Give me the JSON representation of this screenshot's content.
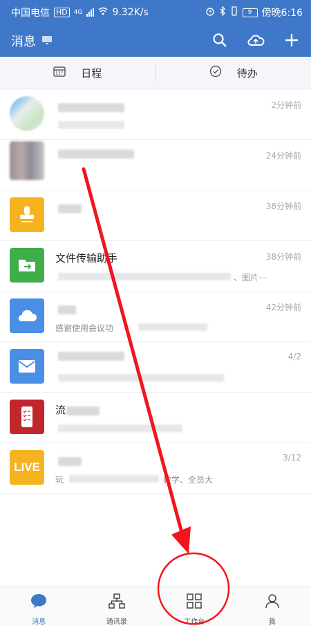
{
  "status_bar": {
    "carrier": "中国电信",
    "hd_badge": "HD",
    "network": "4G",
    "speed": "9.32K/s",
    "battery": "9",
    "time": "傍晚6:16"
  },
  "app_bar": {
    "title": "消息",
    "monitor_icon": "monitor-icon",
    "search_icon": "search-icon",
    "cloud_icon": "cloud-icon",
    "add_icon": "plus-icon"
  },
  "sub_tabs": [
    {
      "label": "日程",
      "icon": "calendar-icon"
    },
    {
      "label": "待办",
      "icon": "check-circle-icon"
    }
  ],
  "messages": [
    {
      "name": "",
      "time": "2分钟前",
      "preview": "",
      "avatar": "blurred-avatar"
    },
    {
      "name": "",
      "time": "24分钟前",
      "preview": "",
      "avatar": "blurred-avatar"
    },
    {
      "name": "",
      "time": "38分钟前",
      "preview": "",
      "avatar": "stamp-icon",
      "avatar_color": "#f5b31f"
    },
    {
      "name": "文件传输助手",
      "time": "38分钟前",
      "preview": "、图片⋯",
      "avatar": "folder-icon",
      "avatar_color": "#3fae49"
    },
    {
      "name": "",
      "time": "42分钟前",
      "preview": "感谢使用会议功",
      "avatar": "cloud-icon",
      "avatar_color": "#4a8ee6"
    },
    {
      "name": "",
      "time": "4/2",
      "preview": "",
      "avatar": "mail-icon",
      "avatar_color": "#4a8ee6"
    },
    {
      "name": "流",
      "time": "",
      "preview": "",
      "avatar": "form-phone-icon",
      "avatar_color": "#c0262c"
    },
    {
      "name": "",
      "time": "3/12",
      "preview": "玩",
      "preview_tail": "教学、全员大",
      "avatar": "live-icon",
      "avatar_text": "LIVE",
      "avatar_color": "#f5b31f"
    }
  ],
  "bottom_nav": [
    {
      "label": "消息",
      "icon": "chat-bubble-icon",
      "active": true
    },
    {
      "label": "通讯录",
      "icon": "org-chart-icon",
      "active": false
    },
    {
      "label": "工作台",
      "icon": "grid-icon",
      "active": false
    },
    {
      "label": "我",
      "icon": "person-icon",
      "active": false
    }
  ],
  "colors": {
    "brand": "#3f78c8",
    "annotation": "#f2141e"
  }
}
